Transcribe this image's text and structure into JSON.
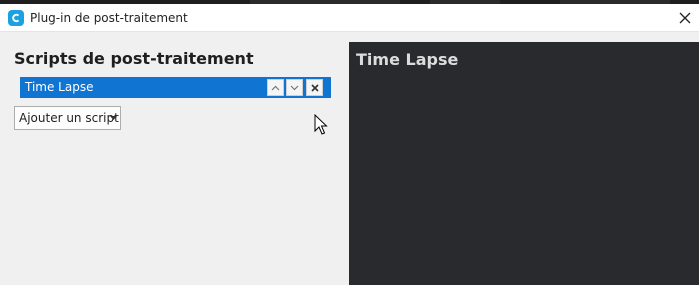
{
  "window": {
    "title": "Plug-in de post-traitement",
    "app_icon": "cura-icon",
    "close_icon": "close-icon"
  },
  "left_panel": {
    "heading": "Scripts de post-traitement",
    "scripts": [
      {
        "label": "Time Lapse",
        "selected": true
      }
    ],
    "add_button_label": "Ajouter un script",
    "item_buttons": [
      "move-up-icon",
      "move-down-icon",
      "remove-icon"
    ]
  },
  "right_panel": {
    "heading": "Time Lapse"
  },
  "colors": {
    "accent": "#0f74d2",
    "dark_panel": "#282a2e",
    "app_icon": "#1aa1e0"
  }
}
